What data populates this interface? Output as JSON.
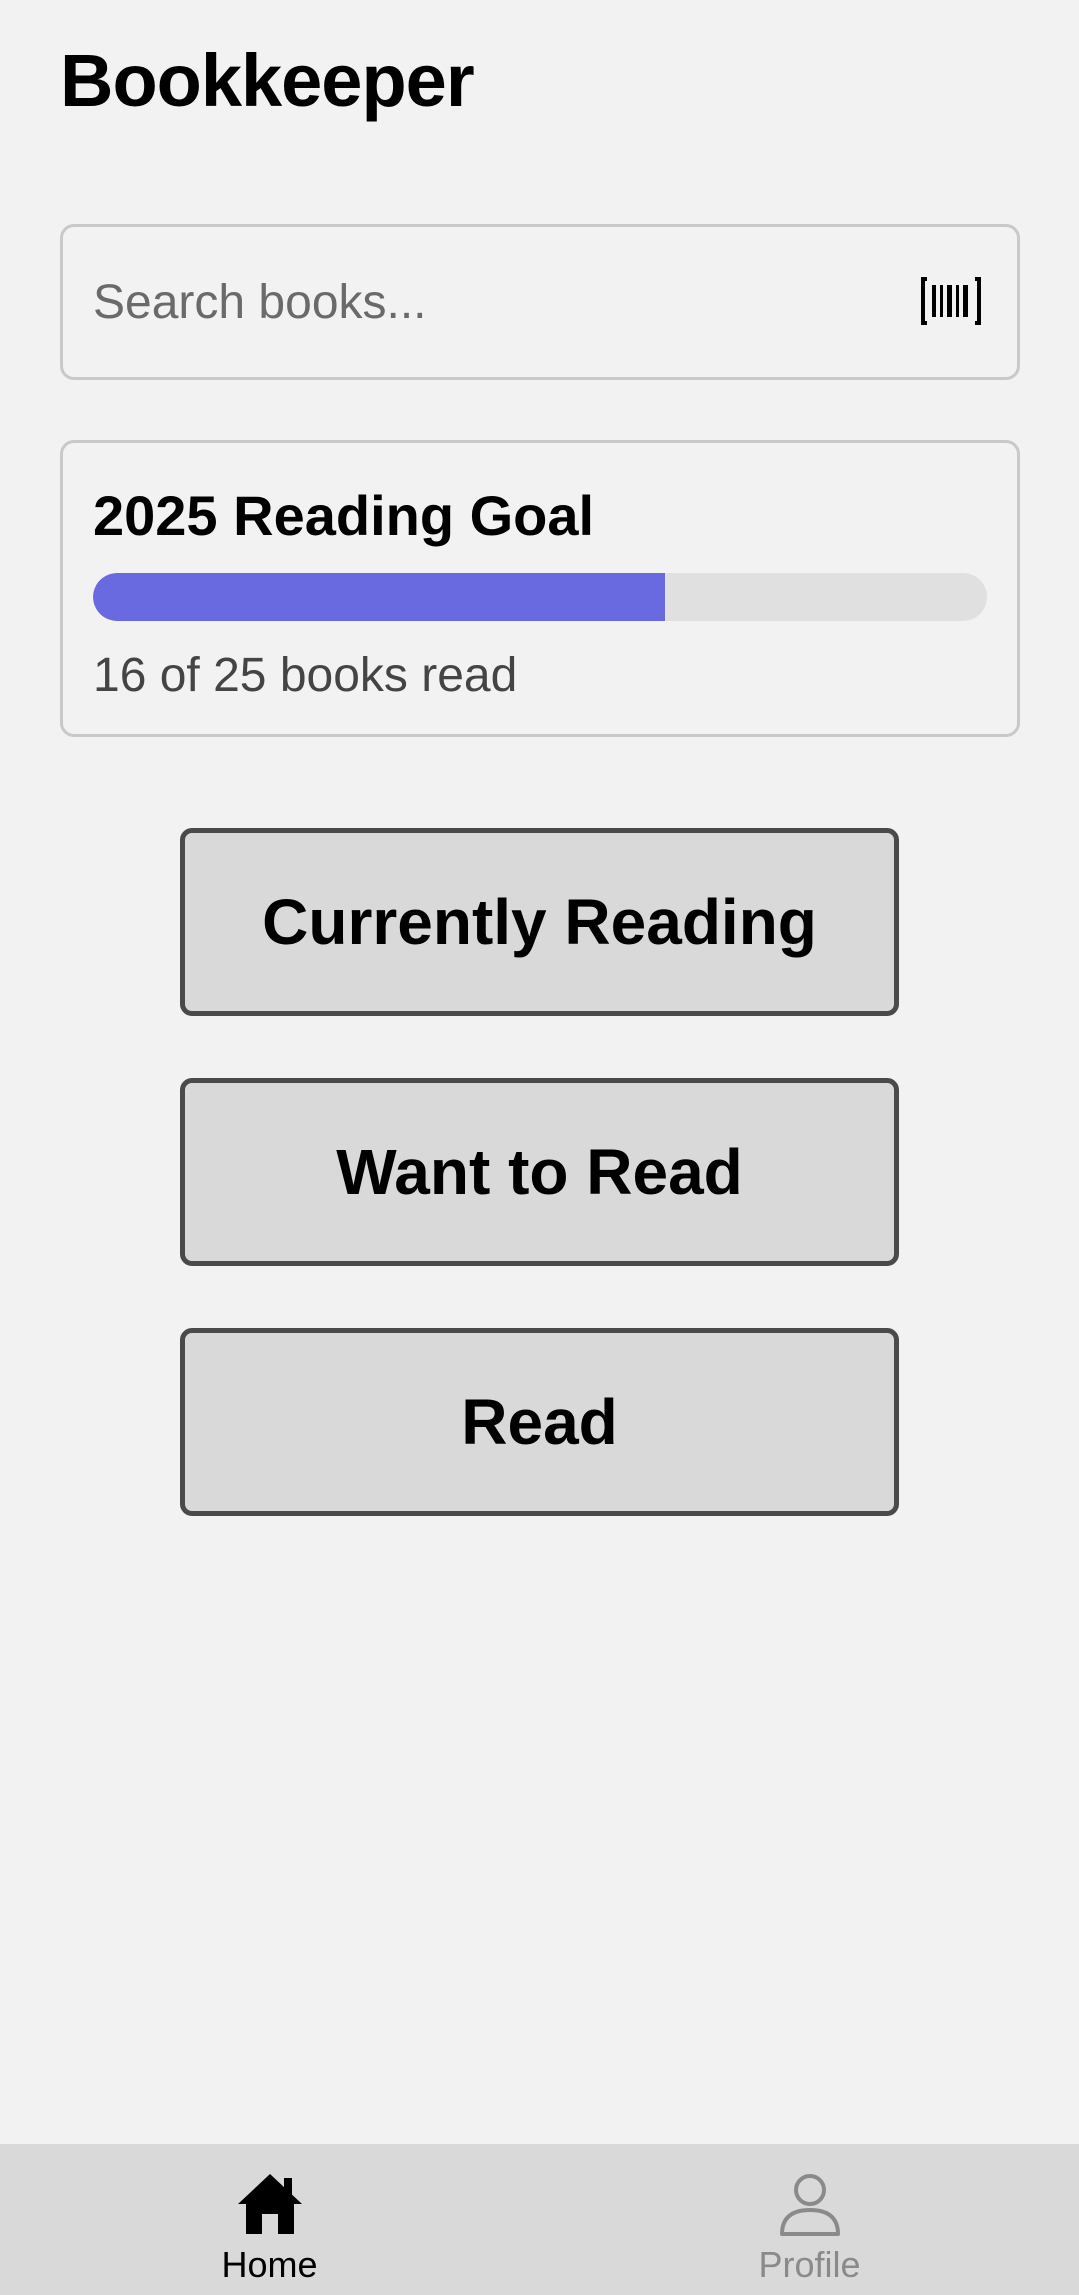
{
  "header": {
    "title": "Bookkeeper"
  },
  "search": {
    "placeholder": "Search books...",
    "value": "",
    "scan_icon": "barcode-scan-icon"
  },
  "reading_goal": {
    "title": "2025 Reading Goal",
    "books_read": 16,
    "books_goal": 25,
    "progress_fraction": 0.64,
    "status_text": "16 of 25 books read",
    "progress_color": "#6a6ae0"
  },
  "shelves": [
    {
      "label": "Currently Reading"
    },
    {
      "label": "Want to Read"
    },
    {
      "label": "Read"
    }
  ],
  "bottom_nav": {
    "items": [
      {
        "label": "Home",
        "icon": "home-icon",
        "active": true
      },
      {
        "label": "Profile",
        "icon": "profile-icon",
        "active": false
      }
    ]
  }
}
